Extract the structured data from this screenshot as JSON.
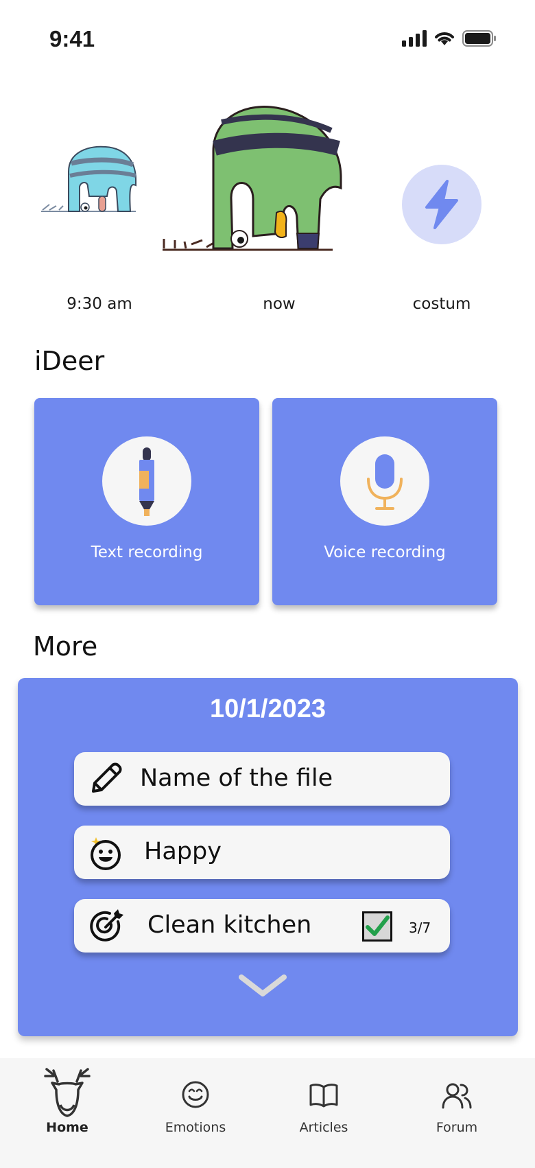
{
  "status_bar": {
    "time": "9:41"
  },
  "moods": [
    {
      "label": "9:30 am",
      "icon": "blue-sleeping-deer-illustration"
    },
    {
      "label": "now",
      "icon": "green-sleeping-deer-illustration"
    },
    {
      "label": "costum",
      "icon": "lightning-bolt-icon"
    }
  ],
  "sections": {
    "primary_title": "iDeer",
    "more_title": "More"
  },
  "recording": {
    "text_label": "Text recording",
    "voice_label": "Voice recording"
  },
  "more": {
    "date": "10/1/2023",
    "entries": [
      {
        "text": "Name of the file",
        "icon": "pencil-icon"
      },
      {
        "text": "Happy",
        "icon": "happy-face-icon"
      },
      {
        "text": "Clean kitchen",
        "icon": "target-icon",
        "checked": true,
        "count": "3/7"
      }
    ]
  },
  "nav": [
    {
      "label": "Home",
      "icon": "deer-icon",
      "active": true
    },
    {
      "label": "Emotions",
      "icon": "smiley-icon",
      "active": false
    },
    {
      "label": "Articles",
      "icon": "book-icon",
      "active": false
    },
    {
      "label": "Forum",
      "icon": "users-icon",
      "active": false
    }
  ],
  "colors": {
    "accent": "#7089ef",
    "lightAccent": "#d7dcf9",
    "checkGreen": "#22a04b",
    "orange": "#f0b25c"
  }
}
